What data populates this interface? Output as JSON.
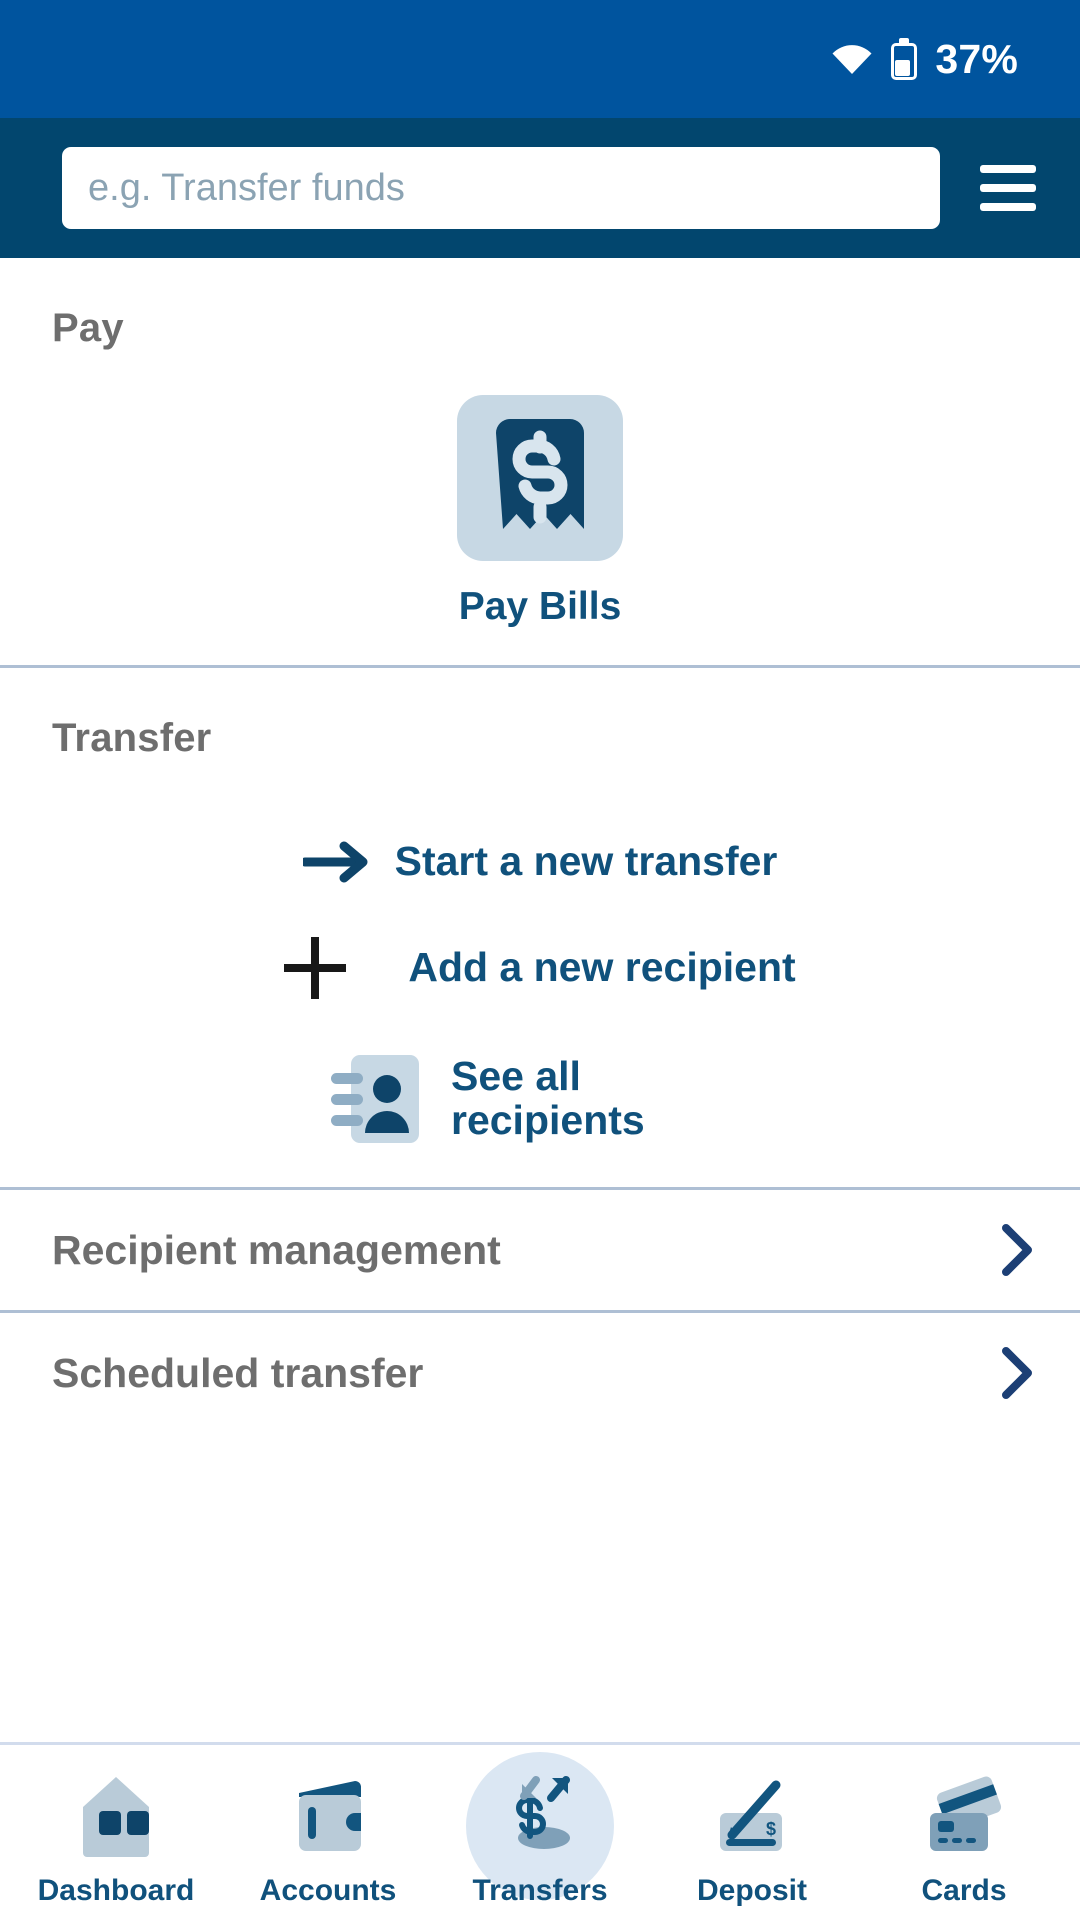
{
  "statusbar": {
    "wifi_icon": "wifi-icon",
    "battery_icon": "battery-icon",
    "battery_percent": "37%"
  },
  "header": {
    "search_placeholder": "e.g. Transfer funds",
    "search_value": "",
    "menu_icon": "hamburger-menu-icon"
  },
  "pay_section": {
    "title": "Pay",
    "tiles": [
      {
        "label": "Pay Bills",
        "icon": "bill-receipt-dollar-icon"
      }
    ]
  },
  "transfer_section": {
    "title": "Transfer",
    "actions": [
      {
        "label": "Start a new transfer",
        "icon": "arrow-right-icon"
      },
      {
        "label": "Add a new recipient",
        "icon": "plus-icon"
      },
      {
        "label": "See all recipients",
        "icon": "address-book-icon"
      }
    ],
    "rows": [
      {
        "label": "Recipient management",
        "chevron": "chevron-right-icon"
      },
      {
        "label": "Scheduled transfer",
        "chevron": "chevron-right-icon"
      }
    ]
  },
  "bottom_nav": {
    "active": "Transfers",
    "items": [
      {
        "label": "Dashboard",
        "icon": "home-icon"
      },
      {
        "label": "Accounts",
        "icon": "wallet-icon"
      },
      {
        "label": "Transfers",
        "icon": "transfer-arrows-dollar-icon"
      },
      {
        "label": "Deposit",
        "icon": "check-deposit-pen-icon"
      },
      {
        "label": "Cards",
        "icon": "credit-cards-icon"
      }
    ]
  },
  "colors": {
    "status_blue": "#00549e",
    "header_blue": "#02466e",
    "navy": "#10517c",
    "deep_navy": "#0e4469",
    "icon_light": "#c7d8e4",
    "gray_text": "#6e6e6e",
    "divider": "#aebfd4",
    "active_bubble": "#dbe7f3"
  }
}
